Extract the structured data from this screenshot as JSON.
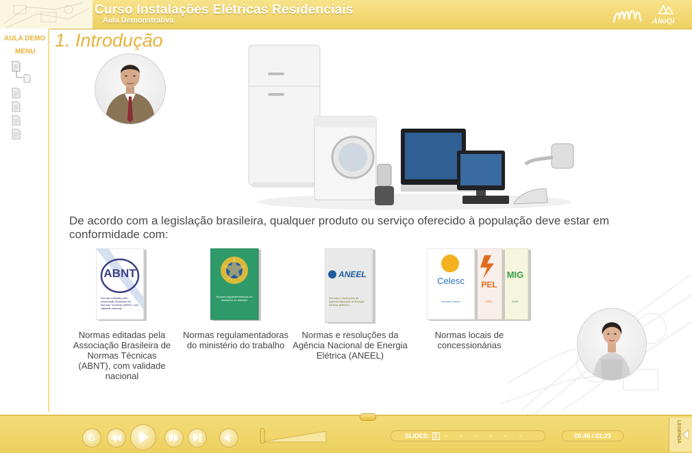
{
  "header": {
    "title": "Curso Instalações Elétricas Residenciais",
    "subtitle": "Aula Demonstrativa",
    "brand_logo_text": "AltoQi",
    "accent": "#e8b23a",
    "bar_color": "#f1d66c"
  },
  "sidebar": {
    "aula_label": "AULA DEMO",
    "menu_label": "MENU",
    "items": [
      {
        "icon": "page-icon"
      },
      {
        "icon": "subpage-icon"
      },
      {
        "icon": "page-icon"
      },
      {
        "icon": "page-icon"
      },
      {
        "icon": "page-icon"
      },
      {
        "icon": "page-icon"
      }
    ]
  },
  "main": {
    "section_title": "1. Introdução",
    "intro_text": "De acordo com a legislação brasileira, qualquer produto ou serviço oferecido à população deve estar em conformidade com:",
    "cards": [
      {
        "cover_title": "ABNT",
        "cover_text": "Normas editadas pela Associação Brasileira de Normas Técnicas (ABNT), com validade nacional",
        "caption": "Normas editadas pela Associação Brasileira de Normas Técnicas (ABNT), com validade nacional"
      },
      {
        "cover_text": "Normas regulamentadoras do ministério do trabalho",
        "caption": "Normas regulamentadoras do ministério do trabalho"
      },
      {
        "cover_title": "ANEEL",
        "cover_text": "Normas e resoluções da Agência Nacional de Energia Elétrica (ANEEL)",
        "caption": "Normas e resoluções da Agência Nacional de Energia Elétrica (ANEEL)"
      },
      {
        "cover_title": "Celesc",
        "cover_text": "Normas Celesc",
        "second_cover_title": "PEL",
        "second_cover_text": "OPEL",
        "third_cover_title": "MIG",
        "third_cover_text": "EMIG",
        "caption": "Normas locais de concessionárias"
      }
    ]
  },
  "player": {
    "slides_label": "SLIDES:",
    "current_slide": "1",
    "time": "00:46 / 01:23",
    "legenda_label": "LEGENDA"
  }
}
